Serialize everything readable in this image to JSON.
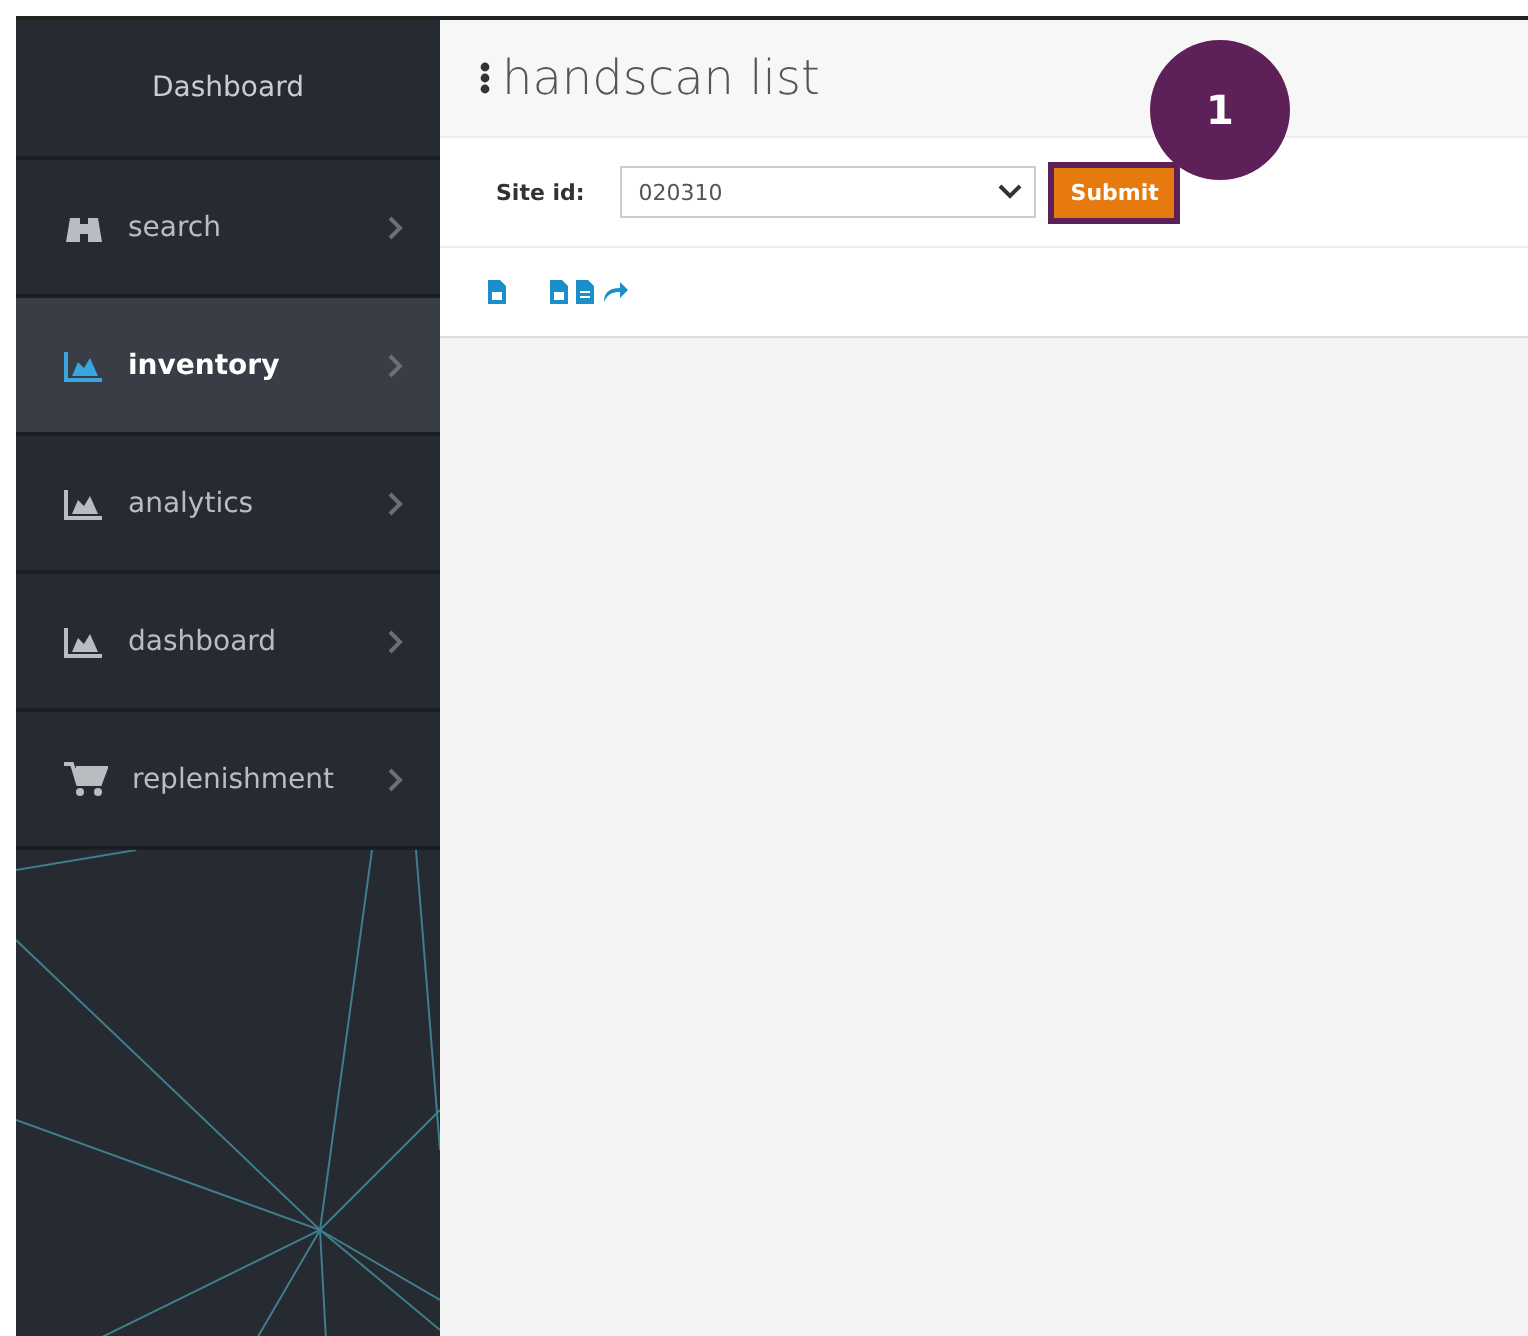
{
  "sidebar": {
    "title": "Dashboard",
    "items": [
      {
        "label": "search",
        "kind": "binoculars",
        "selected": false
      },
      {
        "label": "inventory",
        "kind": "chart",
        "selected": true
      },
      {
        "label": "analytics",
        "kind": "chart",
        "selected": false
      },
      {
        "label": "dashboard",
        "kind": "chart",
        "selected": false
      },
      {
        "label": "replenishment",
        "kind": "cart",
        "selected": false
      }
    ]
  },
  "page": {
    "title": "handscan list"
  },
  "form": {
    "label": "Site id:",
    "value": "020310",
    "submit": "Submit"
  },
  "toolbar": [
    {
      "kind": "file"
    },
    {
      "kind": "file"
    },
    {
      "kind": "text"
    },
    {
      "kind": "share"
    }
  ],
  "callout": {
    "number": "1"
  }
}
